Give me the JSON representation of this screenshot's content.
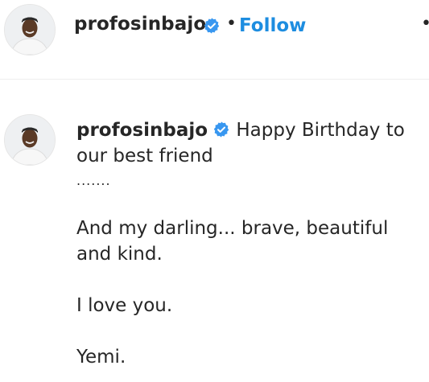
{
  "header": {
    "username": "profosinbajo",
    "separator": "•",
    "follow_label": "Follow",
    "more_label": "•",
    "verified_icon": "verified-badge-icon",
    "verified_color": "#3897f0"
  },
  "post": {
    "username": "profosinbajo",
    "caption_first": "Happy Birthday to our best friend",
    "caption_dots": ".......",
    "caption_line2": "And my darling... brave, beautiful and kind.",
    "caption_line3": "I love you.",
    "caption_line4": "Yemi."
  },
  "colors": {
    "follow": "#1d8de0",
    "text": "#262626",
    "divider": "#efefef"
  }
}
